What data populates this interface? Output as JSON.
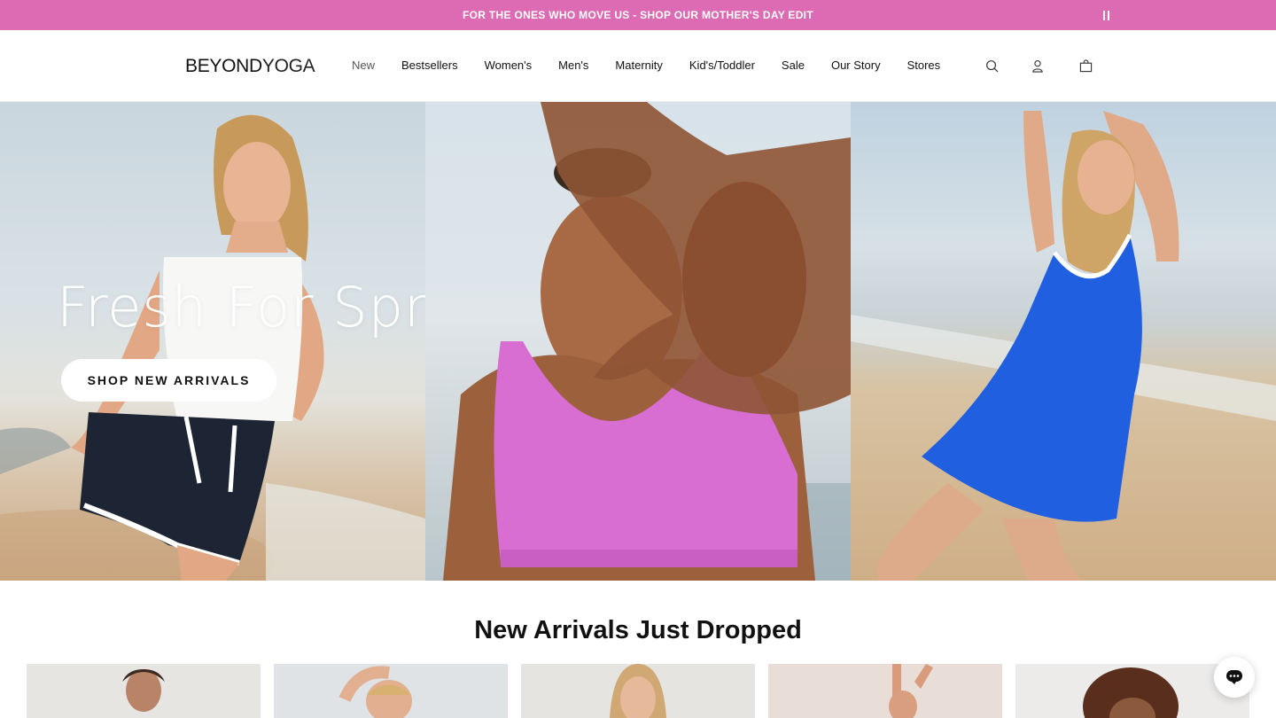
{
  "announcement": {
    "text": "FOR THE ONES WHO MOVE US - SHOP OUR MOTHER'S DAY EDIT",
    "background": "#dd6bb3",
    "pause_icon": "pause-icon"
  },
  "header": {
    "logo": {
      "part1": "BEYOND",
      "part2": "YOGA"
    },
    "nav": [
      {
        "label": "New",
        "active": true
      },
      {
        "label": "Bestsellers"
      },
      {
        "label": "Women's"
      },
      {
        "label": "Men's"
      },
      {
        "label": "Maternity"
      },
      {
        "label": "Kid's/Toddler"
      },
      {
        "label": "Sale"
      },
      {
        "label": "Our Story"
      },
      {
        "label": "Stores"
      }
    ],
    "icons": [
      "search-icon",
      "account-icon",
      "cart-icon"
    ]
  },
  "hero": {
    "title": "Fresh For Spring",
    "cta": "SHOP NEW ARRIVALS",
    "panels": [
      "woman-white-tank-navy-shorts-beach",
      "woman-pink-sports-bra-hand",
      "woman-blue-dress-beach"
    ]
  },
  "section": {
    "title": "New Arrivals Just Dropped",
    "products_visible": 5
  },
  "chat": {
    "icon": "chat-icon"
  }
}
